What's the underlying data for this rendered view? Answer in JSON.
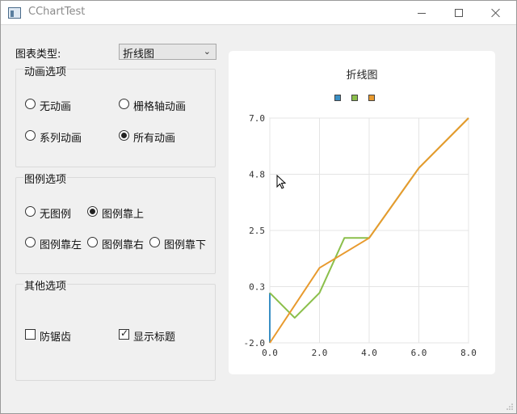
{
  "window": {
    "title": "CChartTest"
  },
  "controls": {
    "chart_type_label": "图表类型:",
    "chart_type_value": "折线图"
  },
  "animation": {
    "title": "动画选项",
    "options": [
      "无动画",
      "栅格轴动画",
      "系列动画",
      "所有动画"
    ],
    "selected": "所有动画"
  },
  "legend_opts": {
    "title": "图例选项",
    "options": [
      "无图例",
      "图例靠上",
      "图例靠左",
      "图例靠右",
      "图例靠下"
    ],
    "selected": "图例靠上"
  },
  "other": {
    "title": "其他选项",
    "antialias_label": "防锯齿",
    "antialias_checked": false,
    "show_title_label": "显示标题",
    "show_title_checked": true
  },
  "chart_data": {
    "type": "line",
    "title": "折线图",
    "legend_placement": "top",
    "xlim": [
      0,
      8
    ],
    "ylim": [
      -2.0,
      7.0
    ],
    "x_ticks": [
      "0.0",
      "2.0",
      "4.0",
      "6.0",
      "8.0"
    ],
    "y_ticks": [
      "7.0",
      "4.8",
      "2.5",
      "0.3",
      "-2.0"
    ],
    "grid": true,
    "series": [
      {
        "color": "#3a8fc4",
        "x": [
          0,
          0
        ],
        "y": [
          -2.0,
          0.0
        ]
      },
      {
        "color": "#8bbf4b",
        "x": [
          0,
          1,
          2,
          3,
          4,
          6,
          8
        ],
        "y": [
          0.0,
          -1.0,
          0.0,
          2.2,
          2.2,
          5.0,
          7.0
        ]
      },
      {
        "color": "#e89a2e",
        "x": [
          0,
          2,
          3,
          4,
          6,
          8
        ],
        "y": [
          -2.0,
          1.0,
          1.6,
          2.2,
          5.0,
          7.0
        ]
      }
    ]
  }
}
